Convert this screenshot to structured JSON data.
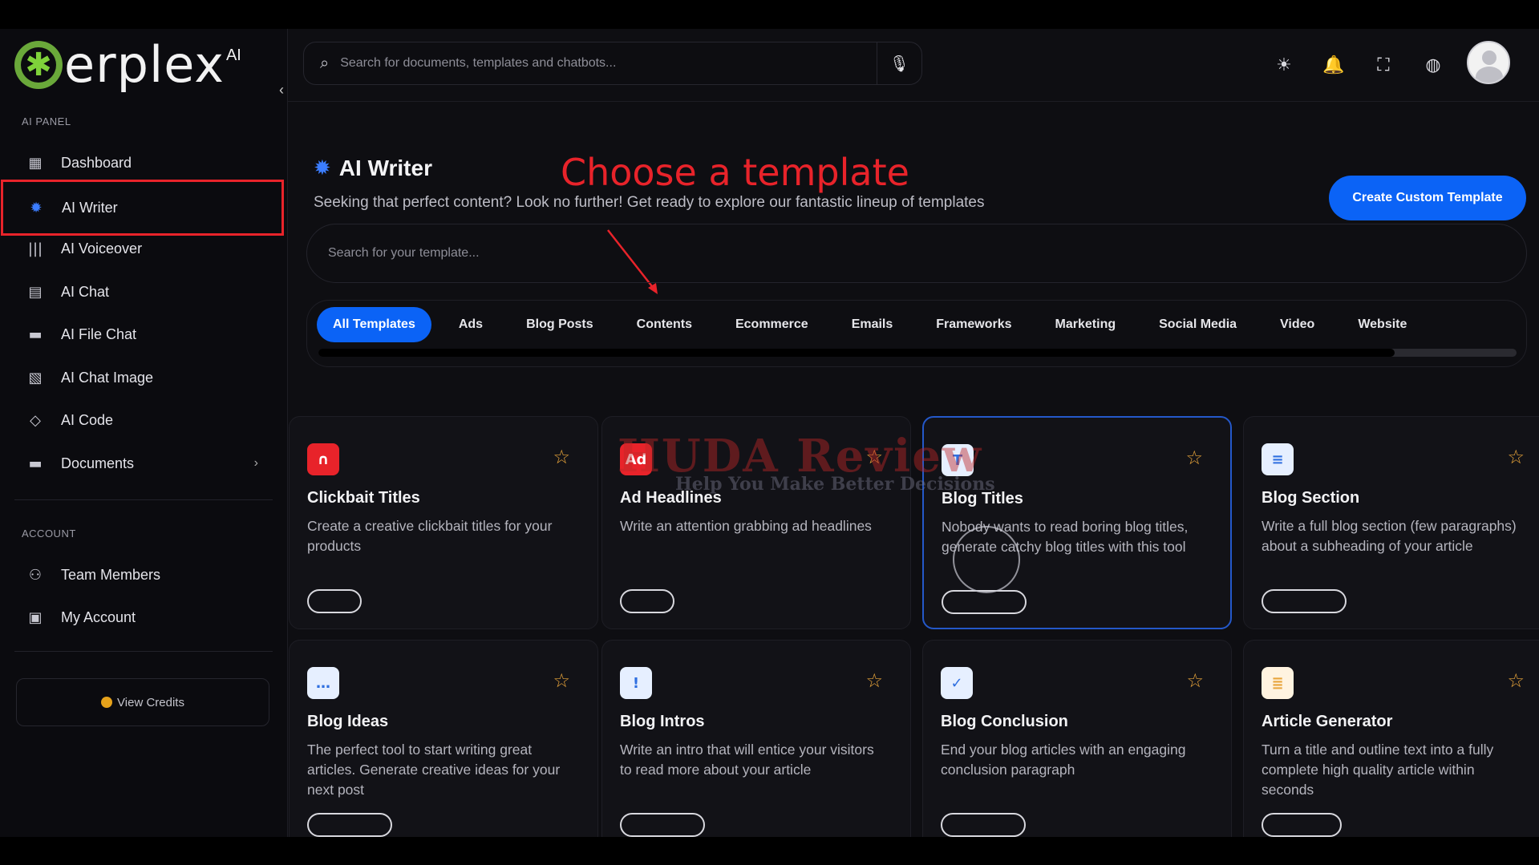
{
  "brand": {
    "name": "erplex",
    "suffix": "AI"
  },
  "header": {
    "search_placeholder": "Search for documents, templates and chatbots..."
  },
  "sidebar": {
    "panel_label": "AI PANEL",
    "items": [
      {
        "label": "Dashboard",
        "icon": "dashboard-icon"
      },
      {
        "label": "AI Writer",
        "icon": "gear-icon"
      },
      {
        "label": "AI Voiceover",
        "icon": "waveform-icon"
      },
      {
        "label": "AI Chat",
        "icon": "chat-icon"
      },
      {
        "label": "AI File Chat",
        "icon": "folder-icon"
      },
      {
        "label": "AI Chat Image",
        "icon": "image-icon"
      },
      {
        "label": "AI Code",
        "icon": "code-icon"
      },
      {
        "label": "Documents",
        "icon": "folder-icon"
      }
    ],
    "account_label": "ACCOUNT",
    "account_items": [
      {
        "label": "Team Members",
        "icon": "team-icon"
      },
      {
        "label": "My Account",
        "icon": "account-icon"
      }
    ],
    "credits_label": "View Credits"
  },
  "main": {
    "title": "AI Writer",
    "annotation": "Choose a template",
    "subtitle": "Seeking that perfect content? Look no further! Get ready to explore our fantastic lineup of templates",
    "create_button": "Create Custom Template",
    "template_search_placeholder": "Search for your template...",
    "tabs": [
      "All Templates",
      "Ads",
      "Blog Posts",
      "Contents",
      "Ecommerce",
      "Emails",
      "Frameworks",
      "Marketing",
      "Social Media",
      "Video",
      "Website"
    ],
    "active_tab": "All Templates"
  },
  "watermark": {
    "title": "HUDA Review",
    "tagline": "Help You Make Better Decisions"
  },
  "cards": [
    {
      "title": "Clickbait Titles",
      "desc": "Create a creative clickbait titles for your products",
      "icon": "headphones-icon",
      "icon_color": "#e8232a"
    },
    {
      "title": "Ad Headlines",
      "desc": "Write an attention grabbing ad headlines",
      "icon": "ad-icon",
      "icon_color": "#e8232a"
    },
    {
      "title": "Blog Titles",
      "desc": "Nobody wants to read boring blog titles, generate catchy blog titles with this tool",
      "icon": "text-icon",
      "icon_color": "#2f6fe0"
    },
    {
      "title": "Blog Section",
      "desc": "Write a full blog section (few paragraphs) about a subheading of your article",
      "icon": "message-icon",
      "icon_color": "#2f6fe0"
    },
    {
      "title": "Blog Ideas",
      "desc": "The perfect tool to start writing great articles. Generate creative ideas for your next post",
      "icon": "chat-bubble-icon",
      "icon_color": "#2f6fe0"
    },
    {
      "title": "Blog Intros",
      "desc": "Write an intro that will entice your visitors to read more about your article",
      "icon": "alert-bubble-icon",
      "icon_color": "#2f6fe0"
    },
    {
      "title": "Blog Conclusion",
      "desc": "End your blog articles with an engaging conclusion paragraph",
      "icon": "check-icon",
      "icon_color": "#2f6fe0"
    },
    {
      "title": "Article Generator",
      "desc": "Turn a title and outline text into a fully complete high quality article within seconds",
      "icon": "document-icon",
      "icon_color": "#e8a43a"
    }
  ]
}
